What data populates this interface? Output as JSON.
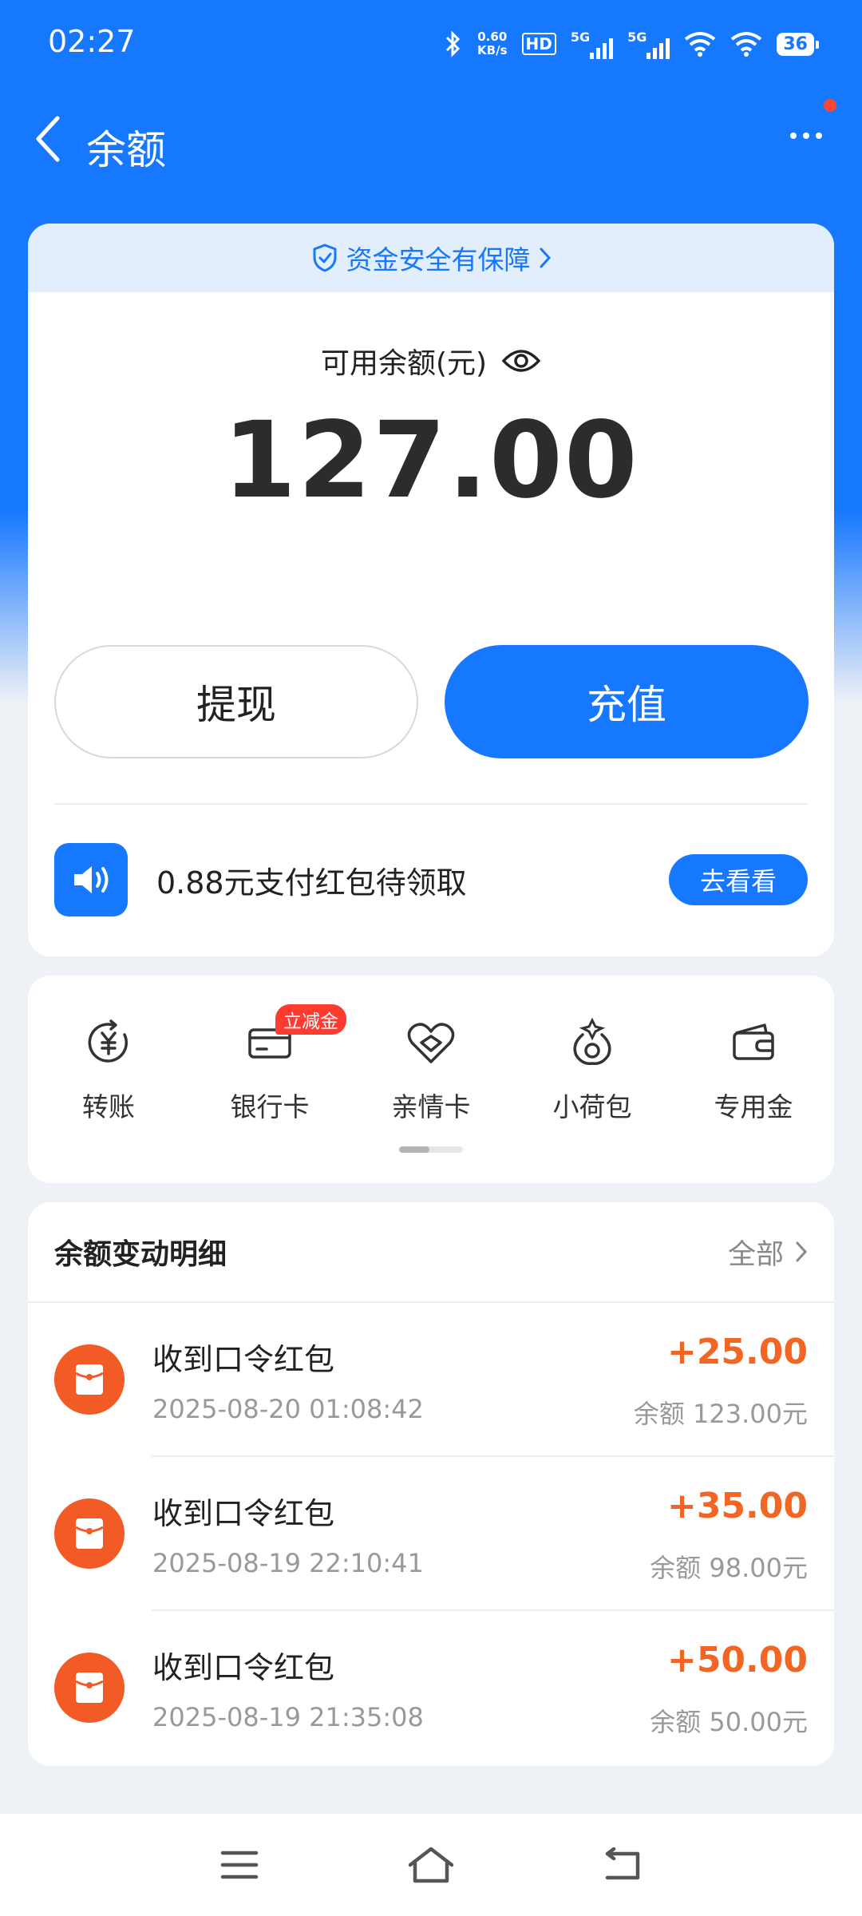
{
  "status_bar": {
    "time": "02:27",
    "speed_value": "0.60",
    "speed_unit": "KB/s",
    "hd_label": "HD",
    "net1_label": "5G",
    "net2_label": "5G",
    "battery": "36"
  },
  "nav": {
    "title": "余额"
  },
  "balance_card": {
    "safety_text": "资金安全有保障",
    "label": "可用余额(元)",
    "amount": "127.00",
    "withdraw_label": "提现",
    "recharge_label": "充值",
    "promo_text": "0.88元支付红包待领取",
    "promo_button": "去看看"
  },
  "shortcuts": {
    "items": [
      {
        "label": "转账",
        "icon": "transfer-icon"
      },
      {
        "label": "银行卡",
        "icon": "bank-card-icon",
        "badge": "立减金"
      },
      {
        "label": "亲情卡",
        "icon": "family-card-icon"
      },
      {
        "label": "小荷包",
        "icon": "small-pouch-icon"
      },
      {
        "label": "专用金",
        "icon": "wallet-icon"
      }
    ]
  },
  "records": {
    "title": "余额变动明细",
    "filter_label": "全部",
    "items": [
      {
        "title": "收到口令红包",
        "time": "2025-08-20 01:08:42",
        "amount": "+25.00",
        "balance": "余额 123.00元"
      },
      {
        "title": "收到口令红包",
        "time": "2025-08-19 22:10:41",
        "amount": "+35.00",
        "balance": "余额 98.00元"
      },
      {
        "title": "收到口令红包",
        "time": "2025-08-19 21:35:08",
        "amount": "+50.00",
        "balance": "余额 50.00元"
      }
    ]
  },
  "colors": {
    "primary": "#1677ff",
    "accent_orange": "#f26522",
    "badge_red": "#ff3b30"
  }
}
